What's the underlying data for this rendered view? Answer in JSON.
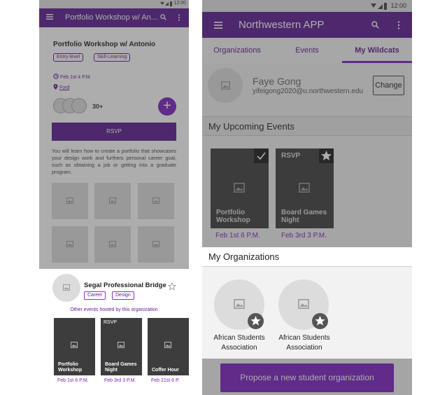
{
  "colors": {
    "primary": "#5b1b90",
    "accent": "#7a1fc2"
  },
  "left_phone": {
    "status_time": "12:00",
    "app_title": "Portfolio Workshop w/ An...",
    "event": {
      "title": "Portfolio Workshop w/ Antonio",
      "tags": [
        "Entry-level",
        "Skill-Learning"
      ],
      "time": "Feb 1st 4 P.M.",
      "location": "Ford",
      "attendee_count": "30+",
      "fab_label": "+",
      "rsvp_label": "RSVP",
      "description": "You will learn how to create a portfolio that showcases your design work and furthers personal career goal, such as obtaining a job or getting into a graduate program."
    },
    "sheet": {
      "org_name": "Segal Professional Bridge",
      "tags": [
        "Career",
        "Design"
      ],
      "subtitle": "Other events hosted by this organization",
      "events": [
        {
          "name": "Portfolio Workshop",
          "rsvp": "",
          "date": "Feb 1st  6 P.M."
        },
        {
          "name": "Board Games Night",
          "rsvp": "RSVP",
          "date": "Feb 3rd  3 P.M."
        },
        {
          "name": "Coffer Hour",
          "rsvp": "",
          "date": "Feb 21st 6 P."
        }
      ]
    }
  },
  "right_phone": {
    "status_time": "12:00",
    "app_title": "Northwestern APP",
    "tabs": [
      {
        "label": "Organizations",
        "active": false
      },
      {
        "label": "Events",
        "active": false
      },
      {
        "label": "My Wildcats",
        "active": true
      }
    ],
    "profile": {
      "name": "Faye Gong",
      "email": "yifeigong2020@u.northwestern.edu",
      "change_label": "Change"
    },
    "upcoming_title": "My Upcoming Events",
    "upcoming_events": [
      {
        "name": "Portfolio Workshop",
        "rsvp": "",
        "badge": "check-icon",
        "date": "Feb 1st  6 P.M."
      },
      {
        "name": "Board Games Night",
        "rsvp": "RSVP",
        "badge": "star-icon",
        "date": "Feb 3rd  3 P.M."
      }
    ],
    "orgs_title": "My Organizations",
    "organizations": [
      {
        "name": "African Students Association"
      },
      {
        "name": "African Students Association"
      }
    ],
    "propose_label": "Propose a new student organization"
  }
}
